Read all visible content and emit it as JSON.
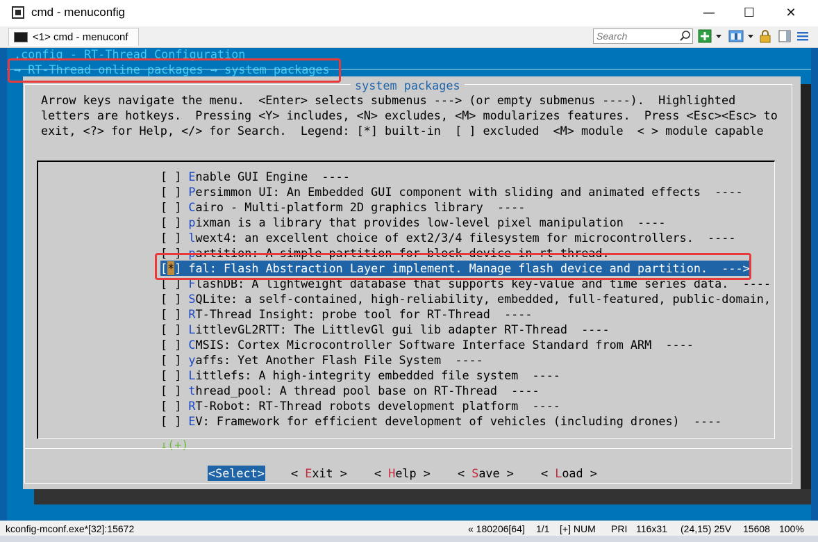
{
  "window": {
    "title": "cmd - menuconfig",
    "minimize": "—",
    "maximize": "☐",
    "close": "✕"
  },
  "tab": {
    "label": "<1> cmd - menuconf"
  },
  "toolbar": {
    "search_placeholder": "Search"
  },
  "terminal": {
    "config_line": ".config - RT-Thread Configuration",
    "breadcrumb": "→ RT-Thread online packages → system packages",
    "dialog_title": "system packages",
    "help_lines": [
      "Arrow keys navigate the menu.  <Enter> selects submenus ---> (or empty submenus ----).  Highlighted",
      "letters are hotkeys.  Pressing <Y> includes, <N> excludes, <M> modularizes features.  Press <Esc><Esc> to",
      "exit, <?> for Help, </> for Search.  Legend: [*] built-in  [ ] excluded  <M> module  < > module capable"
    ],
    "items": [
      {
        "box": "[ ] ",
        "hot": "E",
        "rest": "nable GUI Engine  ----"
      },
      {
        "box": "[ ] ",
        "hot": "P",
        "rest": "ersimmon UI: An Embedded GUI component with sliding and animated effects  ----"
      },
      {
        "box": "[ ] ",
        "hot": "C",
        "rest": "airo - Multi-platform 2D graphics library  ----"
      },
      {
        "box": "[ ] ",
        "hot": "p",
        "rest": "ixman is a library that provides low-level pixel manipulation  ----"
      },
      {
        "box": "[ ] ",
        "hot": "l",
        "rest": "wext4: an excellent choice of ext2/3/4 filesystem for microcontrollers.  ----"
      },
      {
        "box": "[ ] ",
        "hot": "p",
        "rest": "artition: A simple partition for block device in rt-thread.  ----"
      },
      {
        "box": "[*] ",
        "hot": "f",
        "rest": "al: Flash Abstraction Layer implement. Manage flash device and partition.  --->",
        "selected": true
      },
      {
        "box": "[ ] ",
        "hot": "F",
        "rest": "lashDB: A lightweight database that supports key-value and time series data.  ----"
      },
      {
        "box": "[ ] ",
        "hot": "S",
        "rest": "QLite: a self-contained, high-reliability, embedded, full-featured, public-domain,"
      },
      {
        "box": "[ ] ",
        "hot": "R",
        "rest": "T-Thread Insight: probe tool for RT-Thread  ----"
      },
      {
        "box": "[ ] ",
        "hot": "L",
        "rest": "ittlevGL2RTT: The LittlevGl gui lib adapter RT-Thread  ----"
      },
      {
        "box": "[ ] ",
        "hot": "C",
        "rest": "MSIS: Cortex Microcontroller Software Interface Standard from ARM  ----"
      },
      {
        "box": "[ ] ",
        "hot": "y",
        "rest": "affs: Yet Another Flash File System  ----"
      },
      {
        "box": "[ ] ",
        "hot": "L",
        "rest": "ittlefs: A high-integrity embedded file system  ----"
      },
      {
        "box": "[ ] ",
        "hot": "t",
        "rest": "hread_pool: A thread pool base on RT-Thread  ----"
      },
      {
        "box": "[ ] ",
        "hot": "R",
        "rest": "T-Robot: RT-Thread robots development platform  ----"
      },
      {
        "box": "[ ] ",
        "hot": "E",
        "rest": "V: Framework for efficient development of vehicles (including drones)  ----"
      }
    ],
    "more_indicator": "↓(+)",
    "buttons": {
      "select": "<Select>",
      "exit_pre": "< ",
      "exit_hot": "E",
      "exit_rest": "xit >",
      "help_pre": "< ",
      "help_hot": "H",
      "help_rest": "elp >",
      "save_pre": "< ",
      "save_hot": "S",
      "save_rest": "ave >",
      "load_pre": "< ",
      "load_hot": "L",
      "load_rest": "oad >"
    }
  },
  "statusbar": {
    "process": "kconfig-mconf.exe*[32]:15672",
    "pos": "« 180206[64]",
    "page": "1/1",
    "mode": "[+] NUM",
    "pri": "PRI",
    "size": "116x31",
    "cursor": "(24,15) 25V",
    "id": "15608",
    "zoom": "100%"
  },
  "colors": {
    "terminal_bg": "#0074b8",
    "dialog_bg": "#cccccc",
    "highlight": "#1f64a6",
    "annotation": "#e83a3a"
  }
}
